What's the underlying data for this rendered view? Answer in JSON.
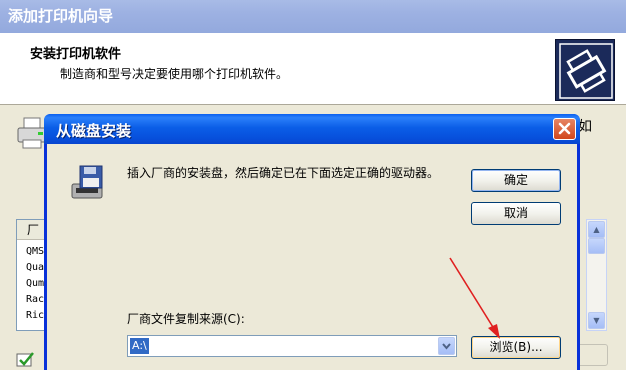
{
  "wizard": {
    "title": "添加打印机向导",
    "heading": "安装打印机软件",
    "subheading": "制造商和型号决定要使用哪个打印机软件。",
    "obscured_text": "如",
    "manufacturer_header": "厂",
    "manufacturers": [
      "QMS",
      "Qua",
      "Qum",
      "Rac",
      "Ric"
    ]
  },
  "dialog": {
    "title": "从磁盘安装",
    "message": "插入厂商的安装盘，然后确定已在下面选定正确的驱动器。",
    "ok_label": "确定",
    "cancel_label": "取消",
    "source_label": "厂商文件复制来源(C):",
    "source_value": "A:\\",
    "browse_label": "浏览(B)..."
  },
  "icons": {
    "close": "close-icon",
    "disk": "floppy-install-icon",
    "printer": "printer-icon",
    "dropdown": "chevron-down-icon"
  },
  "colors": {
    "dialog_titlebar": "#0b5ee7",
    "wizard_titlebar": "#9db1e2",
    "close_button": "#d2471d",
    "selection": "#316ac5",
    "annotation_arrow": "#e02020"
  }
}
